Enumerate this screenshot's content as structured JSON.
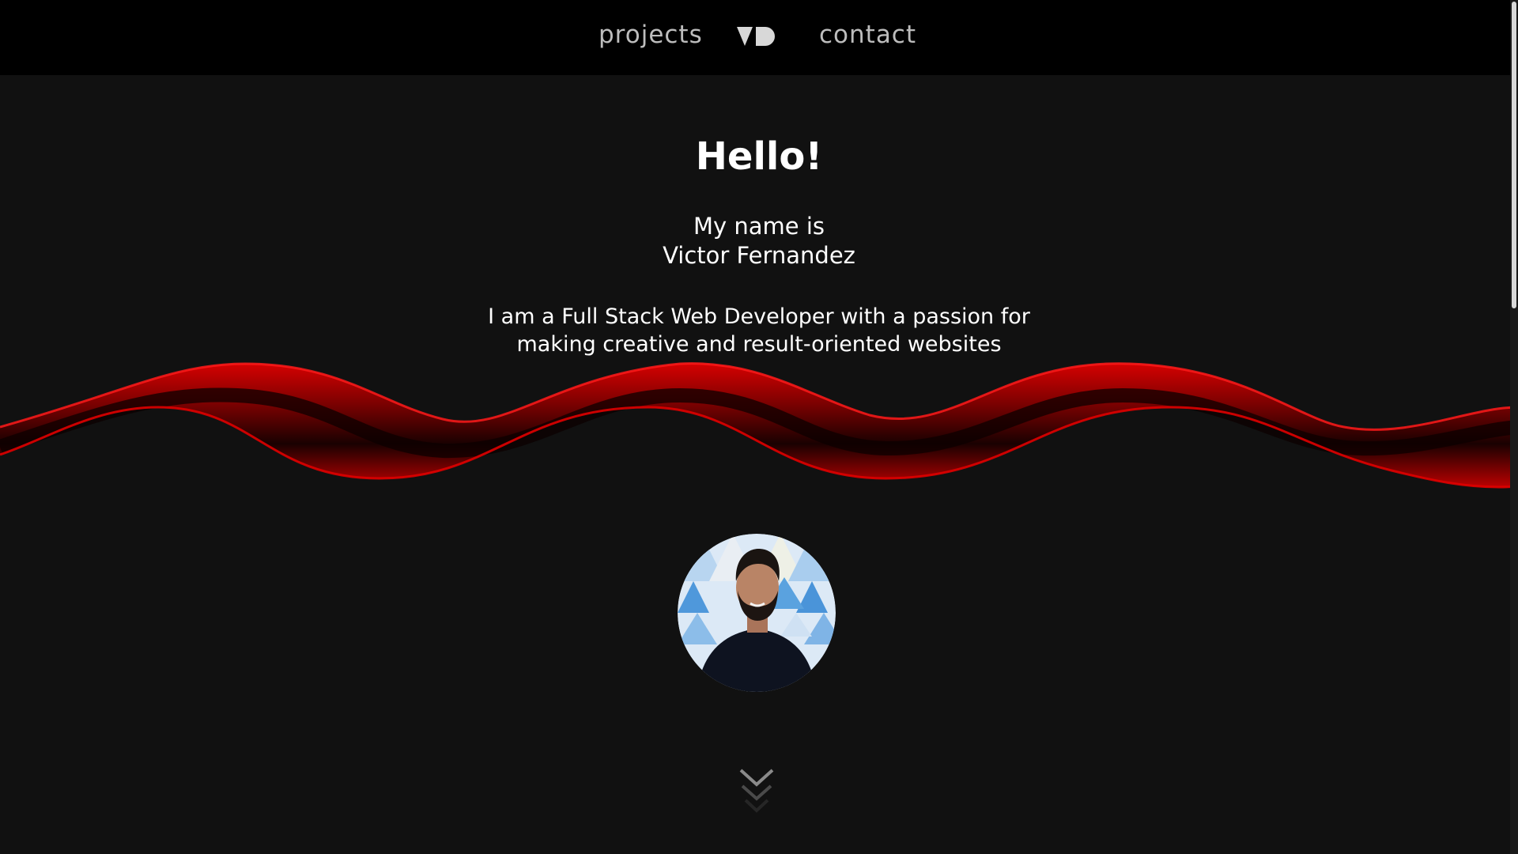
{
  "nav": {
    "left_link": "projects",
    "logo_icon": "vd-monogram-icon",
    "right_link": "contact"
  },
  "hero": {
    "title": "Hello!",
    "name_line1": "My name is",
    "name_line2": "Victor Fernandez",
    "tagline_line1": "I am a Full Stack Web Developer with a passion for",
    "tagline_line2": "making creative and result-oriented websites"
  },
  "avatar_icon": "profile-photo",
  "scroll_icon": "chevron-down-icon",
  "colors": {
    "nav_bg": "#000000",
    "page_bg": "#111111",
    "accent_red": "#d90000",
    "text": "#ffffff",
    "nav_text": "#bdbdbd"
  }
}
